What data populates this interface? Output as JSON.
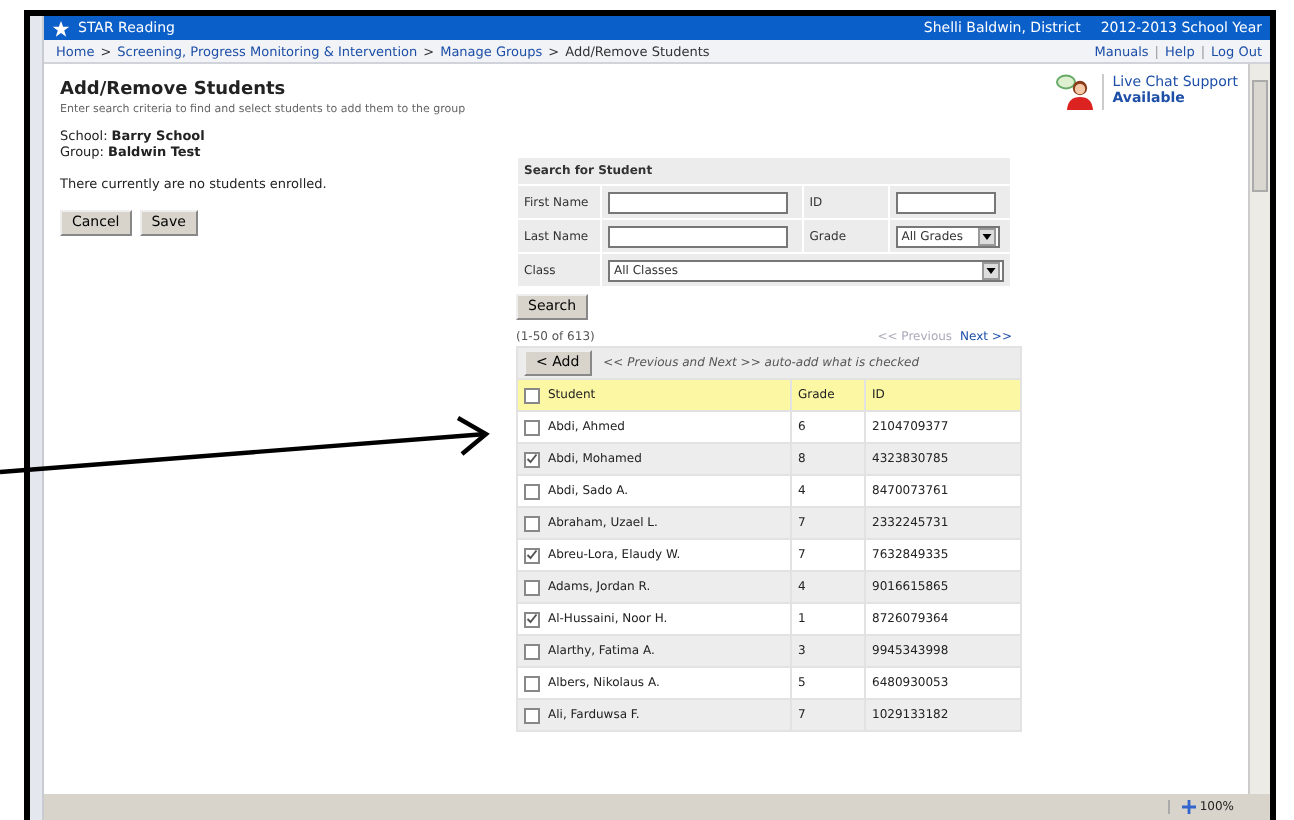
{
  "app_bar": {
    "title": "STAR Reading",
    "user": "Shelli Baldwin, District",
    "school_year": "2012-2013 School Year"
  },
  "breadcrumb": [
    {
      "text": "Home",
      "kind": "link"
    },
    {
      "text": ">",
      "kind": "separator"
    },
    {
      "text": "Screening, Progress Monitoring & Intervention",
      "kind": "link"
    },
    {
      "text": ">",
      "kind": "separator"
    },
    {
      "text": "Manage Groups",
      "kind": "link"
    },
    {
      "text": ">",
      "kind": "separator"
    },
    {
      "text": "Add/Remove Students",
      "kind": "current"
    }
  ],
  "header_links": [
    {
      "text": "Manuals",
      "kind": "link"
    },
    {
      "text": "|",
      "kind": "separator"
    },
    {
      "text": "Help",
      "kind": "link"
    },
    {
      "text": "|",
      "kind": "separator"
    },
    {
      "text": "Log Out",
      "kind": "link"
    }
  ],
  "page": {
    "title": "Add/Remove Students",
    "subtitle": "Enter search criteria to find and select students to add them to the group",
    "school_label": "School:",
    "school": "Barry School",
    "group_label": "Group:",
    "group": "Baldwin Test",
    "enrolled_message": "There currently are no students enrolled.",
    "buttons": [
      "Cancel",
      "Save"
    ]
  },
  "live_chat": {
    "link": "Live Chat Support",
    "status": "Available"
  },
  "search": {
    "title": "Search for Student",
    "fields": [
      {
        "label": "First Name",
        "kind": "text"
      },
      {
        "label": "ID",
        "kind": "text"
      },
      {
        "label": "Last Name",
        "kind": "text"
      },
      {
        "label": "Grade",
        "kind": "select",
        "value": "All Grades"
      },
      {
        "label": "Class",
        "kind": "select",
        "value": "All Classes"
      }
    ],
    "button": "Search"
  },
  "results": {
    "count": "(1-50 of 613)",
    "previous": {
      "text": "<< Previous",
      "disabled": true
    },
    "next": {
      "text": "Next >>",
      "disabled": false
    },
    "add_button": "< Add",
    "hint": "<< Previous and Next >> auto-add what is checked",
    "columns": [
      "Student",
      "Grade",
      "ID"
    ],
    "header_checked": false,
    "rows": [
      {
        "student": "Abdi, Ahmed",
        "grade": "6",
        "id": "2104709377",
        "checked": false
      },
      {
        "student": "Abdi, Mohamed",
        "grade": "8",
        "id": "4323830785",
        "checked": true
      },
      {
        "student": "Abdi, Sado A.",
        "grade": "4",
        "id": "8470073761",
        "checked": false
      },
      {
        "student": "Abraham, Uzael L.",
        "grade": "7",
        "id": "2332245731",
        "checked": false
      },
      {
        "student": "Abreu-Lora, Elaudy W.",
        "grade": "7",
        "id": "7632849335",
        "checked": true
      },
      {
        "student": "Adams, Jordan R.",
        "grade": "4",
        "id": "9016615865",
        "checked": false
      },
      {
        "student": "Al-Hussaini, Noor H.",
        "grade": "1",
        "id": "8726079364",
        "checked": true
      },
      {
        "student": "Alarthy, Fatima A.",
        "grade": "3",
        "id": "9945343998",
        "checked": false
      },
      {
        "student": "Albers, Nikolaus A.",
        "grade": "5",
        "id": "6480930053",
        "checked": false
      },
      {
        "student": "Ali, Farduwsa F.",
        "grade": "7",
        "id": "1029133182",
        "checked": false
      }
    ]
  },
  "status_bar": {
    "zoom": "100%"
  }
}
